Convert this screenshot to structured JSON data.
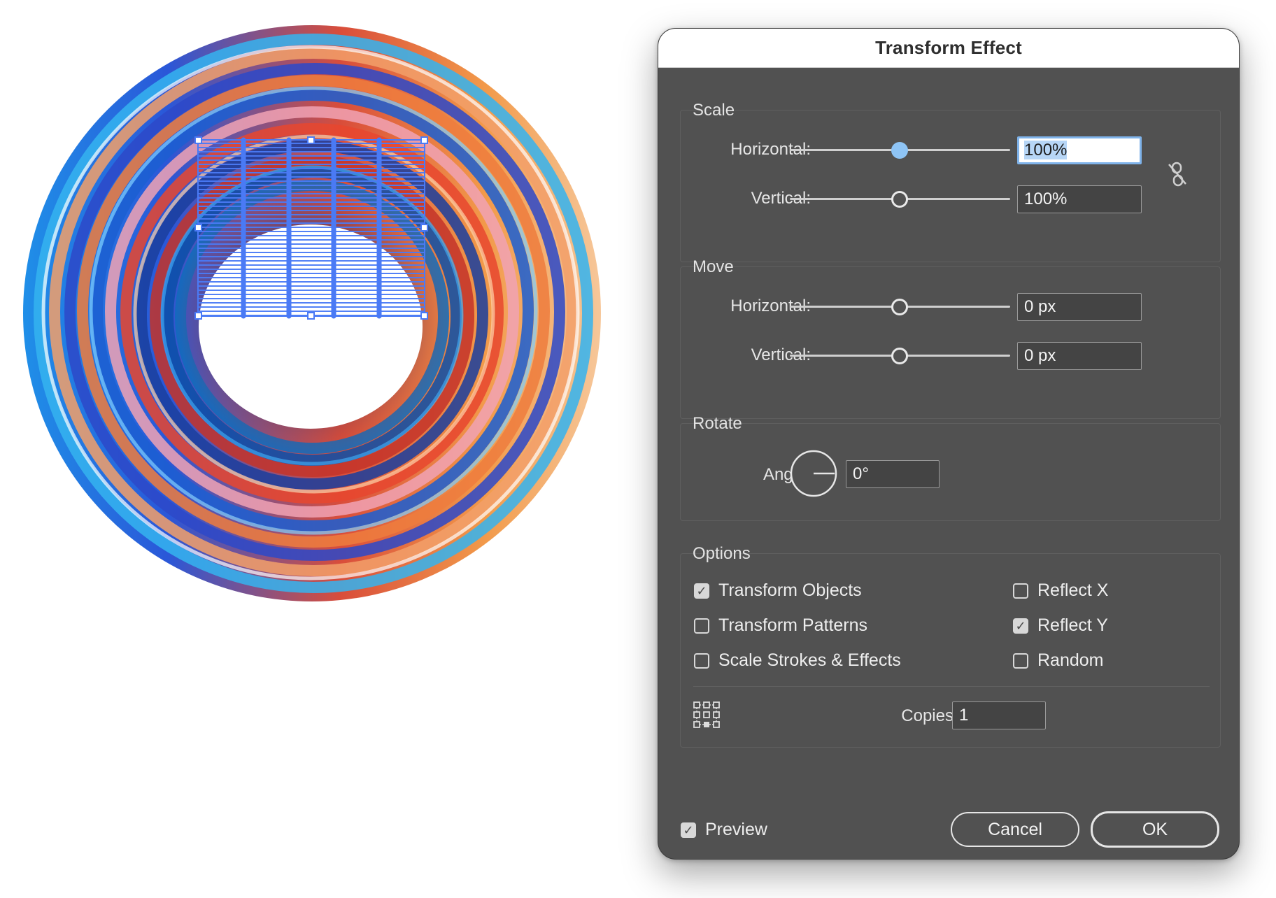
{
  "dialog": {
    "title": "Transform Effect",
    "scale": {
      "label": "Scale",
      "horizontal_label": "Horizontal:",
      "horizontal_value": "100%",
      "vertical_label": "Vertical:",
      "vertical_value": "100%",
      "link_icon": "unlink-proportions-icon"
    },
    "move": {
      "label": "Move",
      "horizontal_label": "Horizontal:",
      "horizontal_value": "0 px",
      "vertical_label": "Vertical:",
      "vertical_value": "0 px"
    },
    "rotate": {
      "label": "Rotate",
      "angle_label": "Angle:",
      "angle_value": "0°"
    },
    "options": {
      "label": "Options",
      "transform_objects": {
        "label": "Transform Objects",
        "checked": true
      },
      "transform_patterns": {
        "label": "Transform Patterns",
        "checked": false
      },
      "scale_strokes": {
        "label": "Scale Strokes & Effects",
        "checked": false
      },
      "reflect_x": {
        "label": "Reflect X",
        "checked": false
      },
      "reflect_y": {
        "label": "Reflect Y",
        "checked": true
      },
      "random": {
        "label": "Random",
        "checked": false
      },
      "reference_point_icon": "reference-point-grid-icon",
      "copies_label": "Copies",
      "copies_value": "1"
    },
    "preview": {
      "label": "Preview",
      "checked": true
    },
    "cancel_label": "Cancel",
    "ok_label": "OK"
  },
  "colors": {
    "dialog_bg": "#515151",
    "selection_blue": "#4a7af5",
    "focus_blue": "#8ec4f5"
  }
}
